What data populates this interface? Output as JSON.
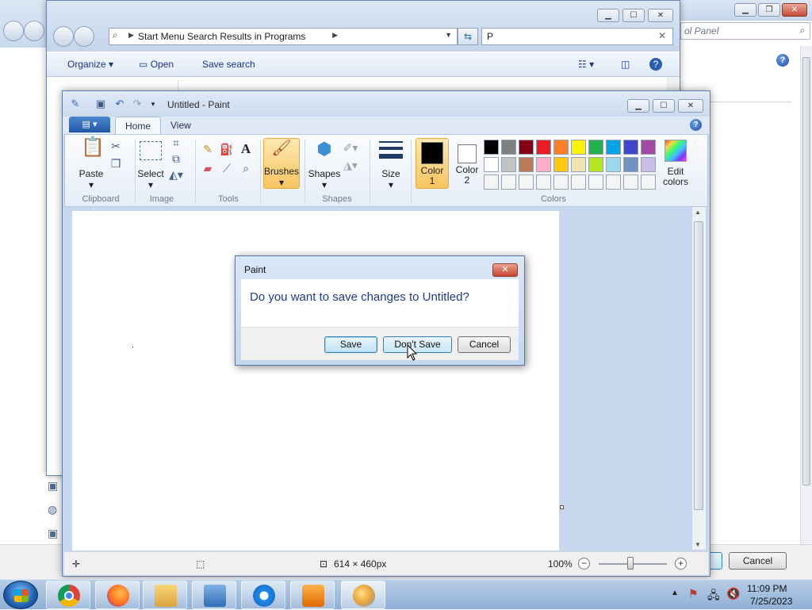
{
  "background": {
    "control_panel": {
      "search_placeholder": "ol Panel",
      "cancel_label": "Cancel"
    }
  },
  "explorer": {
    "address": "Start Menu Search Results in Programs",
    "search_value": "P",
    "toolbar": {
      "organize": "Organize",
      "open": "Open",
      "save_search": "Save search"
    }
  },
  "paint": {
    "title": "Untitled - Paint",
    "tabs": [
      "Home",
      "View"
    ],
    "groups": {
      "clipboard": "Clipboard",
      "image": "Image",
      "tools": "Tools",
      "shapes": "Shapes",
      "colors": "Colors"
    },
    "buttons": {
      "paste": "Paste",
      "select": "Select",
      "brushes": "Brushes",
      "shapes": "Shapes",
      "size": "Size",
      "color1_line1": "Color",
      "color1_line2": "1",
      "color2_line1": "Color",
      "color2_line2": "2",
      "edit_colors_line1": "Edit",
      "edit_colors_line2": "colors"
    },
    "colors": {
      "color1": "#000000",
      "color2": "#ffffff",
      "palette_row1": [
        "#000000",
        "#7f7f7f",
        "#880015",
        "#ed1c24",
        "#ff7f27",
        "#fff200",
        "#22b14c",
        "#00a2e8",
        "#3f48cc",
        "#a349a4"
      ],
      "palette_row2": [
        "#ffffff",
        "#c3c3c3",
        "#b97a57",
        "#ffaec9",
        "#ffc90e",
        "#efe4b0",
        "#b5e61d",
        "#99d9ea",
        "#7092be",
        "#c8bfe7"
      ],
      "palette_row3": [
        "#f5f5f5",
        "#f5f5f5",
        "#f5f5f5",
        "#f5f5f5",
        "#f5f5f5",
        "#f5f5f5",
        "#f5f5f5",
        "#f5f5f5",
        "#f5f5f5",
        "#f5f5f5"
      ]
    },
    "status": {
      "canvas_size": "614 × 460px",
      "zoom": "100%"
    }
  },
  "dialog": {
    "title": "Paint",
    "message": "Do you want to save changes to Untitled?",
    "save": "Save",
    "dont_save": "Don't Save",
    "cancel": "Cancel"
  },
  "taskbar": {
    "time": "11:09 PM",
    "date": "7/25/2023"
  }
}
